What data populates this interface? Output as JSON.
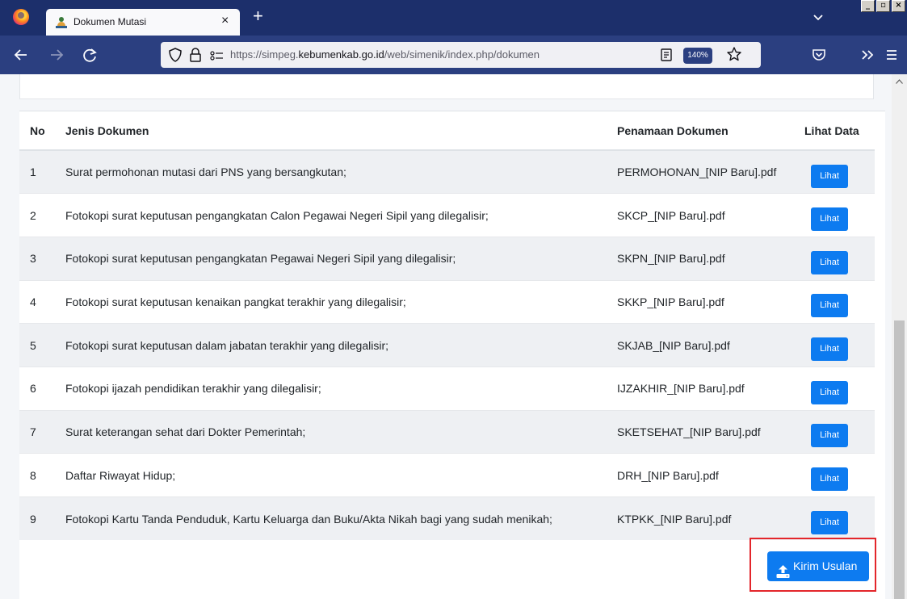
{
  "browser": {
    "tab_title": "Dokumen Mutasi",
    "tab_close": "×",
    "new_tab": "+",
    "url_scheme": "https://simpeg.",
    "url_domain": "kebumenkab.go.id",
    "url_path": "/web/simenik/index.php/dokumen",
    "zoom": "140%",
    "window_controls": [
      "_",
      "▫",
      "×"
    ]
  },
  "table": {
    "headers": {
      "no": "No",
      "jenis": "Jenis Dokumen",
      "nama": "Penamaan Dokumen",
      "lihat": "Lihat Data"
    },
    "rows": [
      {
        "no": "1",
        "jenis": "Surat permohonan mutasi dari PNS yang bersangkutan;",
        "nama": "PERMOHONAN_[NIP Baru].pdf",
        "lihat": "Lihat"
      },
      {
        "no": "2",
        "jenis": "Fotokopi surat keputusan pengangkatan Calon Pegawai Negeri Sipil yang dilegalisir;",
        "nama": "SKCP_[NIP Baru].pdf",
        "lihat": "Lihat"
      },
      {
        "no": "3",
        "jenis": "Fotokopi surat keputusan pengangkatan Pegawai Negeri Sipil yang dilegalisir;",
        "nama": "SKPN_[NIP Baru].pdf",
        "lihat": "Lihat"
      },
      {
        "no": "4",
        "jenis": "Fotokopi surat keputusan kenaikan pangkat terakhir yang dilegalisir;",
        "nama": "SKKP_[NIP Baru].pdf",
        "lihat": "Lihat"
      },
      {
        "no": "5",
        "jenis": "Fotokopi surat keputusan dalam jabatan terakhir yang dilegalisir;",
        "nama": "SKJAB_[NIP Baru].pdf",
        "lihat": "Lihat"
      },
      {
        "no": "6",
        "jenis": "Fotokopi ijazah pendidikan terakhir yang dilegalisir;",
        "nama": "IJZAKHIR_[NIP Baru].pdf",
        "lihat": "Lihat"
      },
      {
        "no": "7",
        "jenis": "Surat keterangan sehat dari Dokter Pemerintah;",
        "nama": "SKETSEHAT_[NIP Baru].pdf",
        "lihat": "Lihat"
      },
      {
        "no": "8",
        "jenis": "Daftar Riwayat Hidup;",
        "nama": "DRH_[NIP Baru].pdf",
        "lihat": "Lihat"
      },
      {
        "no": "9",
        "jenis": "Fotokopi Kartu Tanda Penduduk, Kartu Keluarga dan Buku/Akta Nikah bagi yang sudah menikah;",
        "nama": "KTPKK_[NIP Baru].pdf",
        "lihat": "Lihat"
      }
    ]
  },
  "submit": {
    "label": "Kirim Usulan",
    "icon": "upload-icon"
  },
  "colors": {
    "primary_button": "#0d7bf0",
    "highlight_border": "#e3262b",
    "tabbar": "#1c2f6b",
    "navbar": "#2b3f80"
  }
}
